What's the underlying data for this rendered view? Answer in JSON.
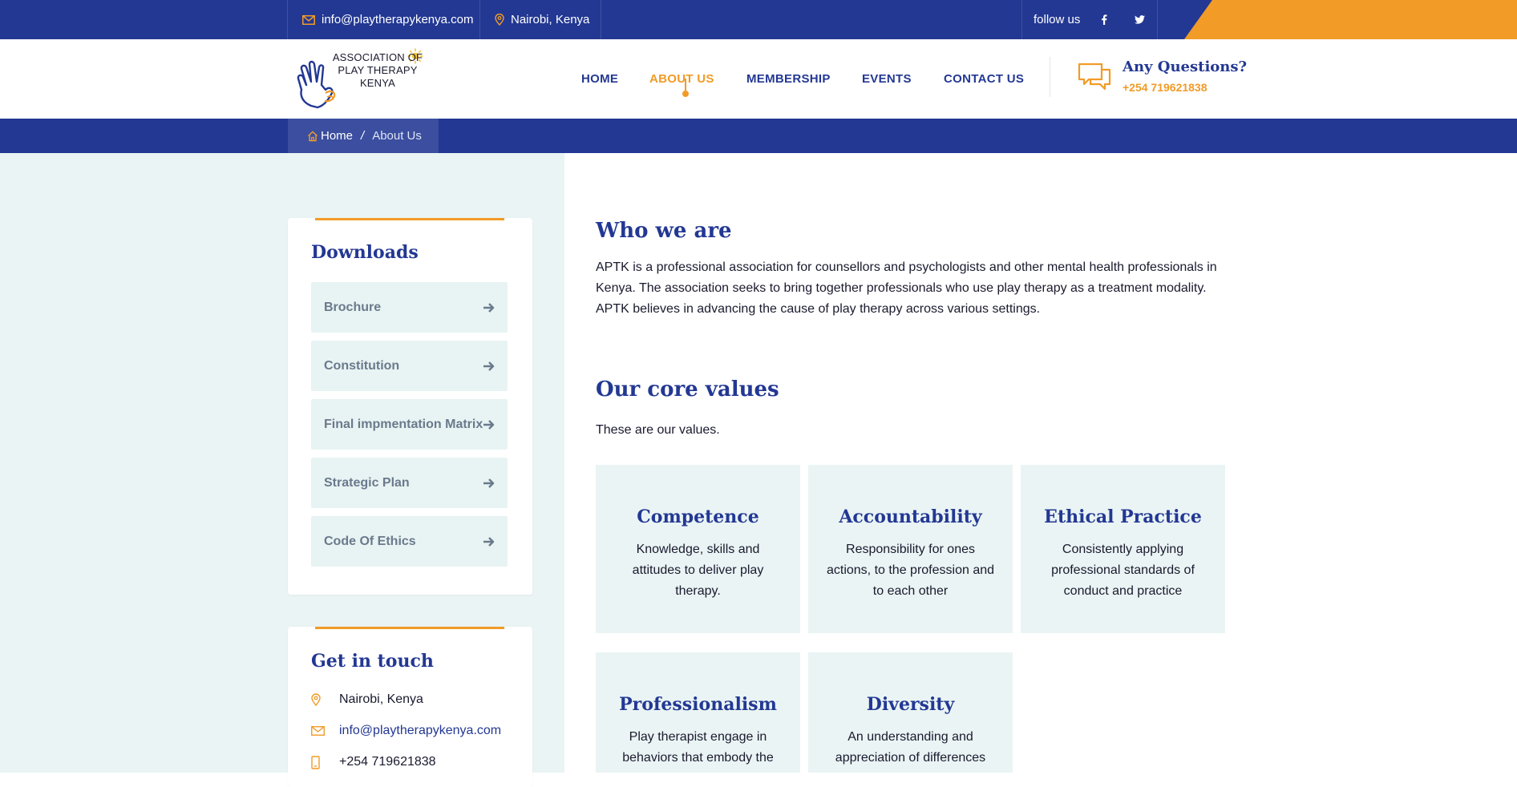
{
  "topbar": {
    "email": "info@playtherapykenya.com",
    "location": "Nairobi, Kenya",
    "follow_label": "follow us",
    "social": [
      "facebook-icon",
      "twitter-icon"
    ]
  },
  "logo": {
    "line1": "ASSOCIATION OF",
    "line2": "PLAY THERAPY",
    "line3": "KENYA"
  },
  "nav": {
    "items": [
      {
        "label": "HOME",
        "active": false
      },
      {
        "label": "ABOUT US",
        "active": true
      },
      {
        "label": "MEMBERSHIP",
        "active": false
      },
      {
        "label": "EVENTS",
        "active": false
      },
      {
        "label": "CONTACT US",
        "active": false
      }
    ]
  },
  "question": {
    "title": "Any Questions?",
    "phone": "+254 719621838"
  },
  "breadcrumb": {
    "home": "Home",
    "separator": "/",
    "current": "About Us"
  },
  "downloads": {
    "title": "Downloads",
    "items": [
      {
        "label": "Brochure"
      },
      {
        "label": "Constitution"
      },
      {
        "label": "Final impmentation Matrix"
      },
      {
        "label": "Strategic Plan"
      },
      {
        "label": "Code Of Ethics"
      }
    ]
  },
  "touch": {
    "title": "Get in touch",
    "location": "Nairobi, Kenya",
    "email": "info@playtherapykenya.com",
    "phone": "+254 719621838"
  },
  "about": {
    "heading": "Who we are",
    "body": "APTK is a professional association for counsellors and psychologists and other mental health professionals in Kenya. The association seeks to bring together professionals who use play therapy as a treatment modality. APTK believes in advancing the cause of play therapy across various settings."
  },
  "values": {
    "heading": "Our core values",
    "intro": "These are our values.",
    "items": [
      {
        "title": "Competence",
        "desc": "Knowledge, skills and attitudes to deliver play therapy."
      },
      {
        "title": "Accountability",
        "desc": "Responsibility for ones actions, to the profession and to each other"
      },
      {
        "title": "Ethical Practice",
        "desc": "Consistently applying professional standards of conduct and practice"
      },
      {
        "title": "Professionalism",
        "desc": "Play therapist engage in behaviors that embody the"
      },
      {
        "title": "Diversity",
        "desc": "An understanding and appreciation of differences"
      }
    ]
  },
  "colors": {
    "primary": "#233893",
    "accent": "#f29b27",
    "pane": "#eaf4f4"
  }
}
